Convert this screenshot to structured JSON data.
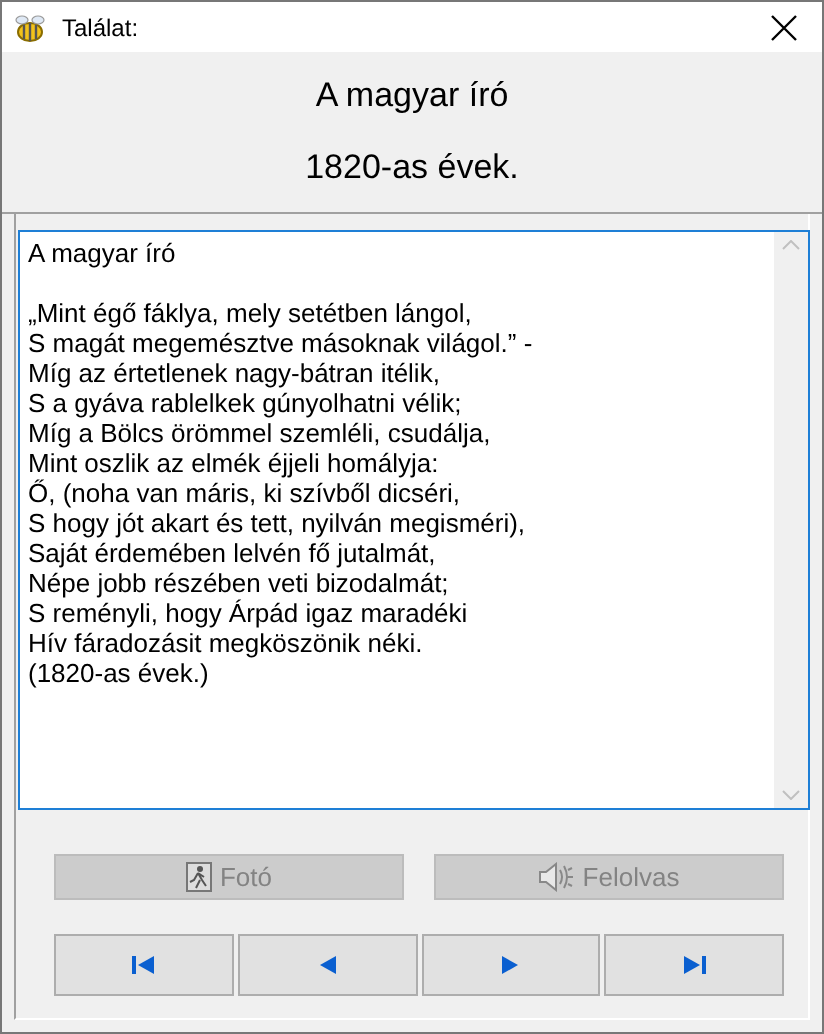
{
  "window": {
    "title": "Találat:"
  },
  "header": {
    "title": "A magyar író",
    "subtitle": "1820-as évek."
  },
  "text_area": {
    "stanzas": [
      [
        "A magyar író"
      ],
      [
        "„Mint égő fáklya, mely setétben lángol,",
        "S magát megemésztve másoknak világol.” -",
        "Míg az értetlenek nagy-bátran itélik,",
        "S a gyáva rablelkek gúnyolhatni vélik;",
        "Míg a Bölcs örömmel szemléli, csudálja,",
        "Mint oszlik az elmék éjjeli homályja:",
        "Ő, (noha van máris, ki szívből dicséri,",
        "S hogy jót akart és tett, nyilván megisméri),",
        "Saját érdemében lelvén fő jutalmát,",
        "Népe jobb részében veti bizodalmát;",
        "S reményli, hogy Árpád igaz maradéki",
        "Hív fáradozásit megköszönik néki.",
        "(1820-as évek.)"
      ]
    ]
  },
  "actions": [
    {
      "kind": "photo",
      "label": "Fotó",
      "disabled": true
    },
    {
      "kind": "read",
      "label": "Felolvas",
      "disabled": true
    }
  ],
  "navigation": [
    {
      "kind": "first"
    },
    {
      "kind": "prev"
    },
    {
      "kind": "next"
    },
    {
      "kind": "last"
    }
  ]
}
